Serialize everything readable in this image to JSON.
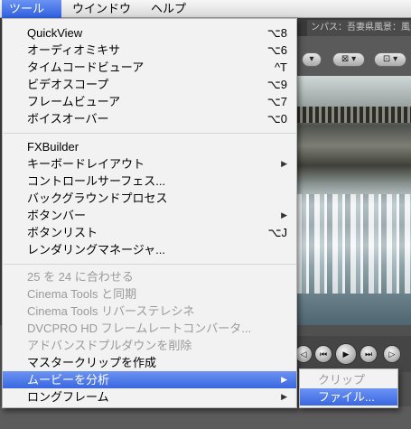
{
  "menubar": {
    "items": [
      {
        "label": "ツール"
      },
      {
        "label": "ウインドウ"
      },
      {
        "label": "ヘルプ"
      }
    ]
  },
  "background": {
    "title_text": "ンパス：吾妻県風景：風景",
    "toolbar_buttons": [
      "▾",
      "⊠ ▾",
      "⊡ ▾"
    ]
  },
  "tools_menu": {
    "group1": [
      {
        "label": "QuickView",
        "shortcut": "⌥8"
      },
      {
        "label": "オーディオミキサ",
        "shortcut": "⌥6"
      },
      {
        "label": "タイムコードビューア",
        "shortcut": "^T"
      },
      {
        "label": "ビデオスコープ",
        "shortcut": "⌥9"
      },
      {
        "label": "フレームビューア",
        "shortcut": "⌥7"
      },
      {
        "label": "ボイスオーバー",
        "shortcut": "⌥0"
      }
    ],
    "group2": [
      {
        "label": "FXBuilder",
        "shortcut": ""
      },
      {
        "label": "キーボードレイアウト",
        "shortcut": "",
        "submenu": true
      },
      {
        "label": "コントロールサーフェス...",
        "shortcut": ""
      },
      {
        "label": "バックグラウンドプロセス",
        "shortcut": ""
      },
      {
        "label": "ボタンバー",
        "shortcut": "",
        "submenu": true
      },
      {
        "label": "ボタンリスト",
        "shortcut": "⌥J"
      },
      {
        "label": "レンダリングマネージャ...",
        "shortcut": ""
      }
    ],
    "group3": [
      {
        "label": "25 を 24 に合わせる",
        "disabled": true
      },
      {
        "label": "Cinema Tools と同期",
        "disabled": true
      },
      {
        "label": "Cinema Tools リバーステレシネ",
        "disabled": true
      },
      {
        "label": "DVCPRO HD フレームレートコンバータ...",
        "disabled": true
      },
      {
        "label": "アドバンスドプルダウンを削除",
        "disabled": true
      },
      {
        "label": "マスタークリップを作成",
        "disabled": false
      },
      {
        "label": "ムービーを分析",
        "disabled": false,
        "submenu": true,
        "highlighted": true
      },
      {
        "label": "ロングフレーム",
        "disabled": false,
        "submenu": true
      }
    ],
    "submenu_arrow": "▶"
  },
  "analyze_submenu": {
    "items": [
      {
        "label": "クリップ",
        "disabled": true
      },
      {
        "label": "ファイル...",
        "highlighted": true
      }
    ]
  },
  "transport": {
    "buttons": [
      "◁",
      "⏮",
      "▶",
      "⏭",
      "▷",
      "⏭"
    ]
  },
  "colors": {
    "highlight": "#3a67e1",
    "menu_bg": "#f8f8f8",
    "disabled_text": "#9a9a9a"
  }
}
